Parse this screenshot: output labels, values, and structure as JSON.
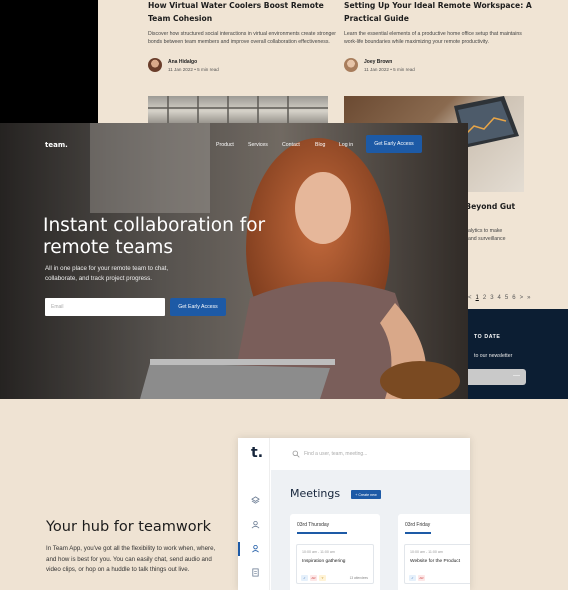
{
  "blog": {
    "posts": [
      {
        "title": "How Virtual Water Coolers Boost Remote Team Cohesion",
        "excerpt": "Discover how structured social interactions in virtual environments create stronger bonds between team members and improve overall collaboration effectiveness.",
        "author": "Ana Hidalgo",
        "meta": "11 Jan 2022  •  5 min read"
      },
      {
        "title": "Setting Up Your Ideal Remote Workspace: A Practical Guide",
        "excerpt": "Learn the essential elements of a productive home office setup that maintains work-life boundaries while maximizing your remote productivity.",
        "author": "Joey Brown",
        "meta": "11 Jan 2022  •  5 min read"
      }
    ],
    "partial_title": "t: Beyond Gut",
    "partial_excerpt": [
      "alytics to make",
      "and surveillance"
    ],
    "pagination": [
      "<",
      "1",
      "2",
      "3",
      "4",
      "5",
      "6",
      ">",
      "»"
    ]
  },
  "newsletter": {
    "title": "TO DATE",
    "subtitle": "to our newsletter",
    "arrow": "—"
  },
  "hero": {
    "logo": "team.",
    "nav": [
      "Product",
      "Services",
      "Contact",
      "Blog",
      "Log in"
    ],
    "nav_cta": "Get Early Access",
    "title": "Instant collaboration for remote teams",
    "subtitle": "All in one place for your remote team to chat, collaborate, and track project progress.",
    "email_placeholder": "Email",
    "cta": "Get Early Access"
  },
  "hub": {
    "title": "Your hub for teamwork",
    "body": "In Team App, you've got all the flexibility to work when, where, and how is best for you. You can easily chat, send audio and video clips, or hop on a huddle to talk things out live."
  },
  "app": {
    "logo": "t.",
    "search_placeholder": "Find a user, team, meeting...",
    "section_title": "Meetings",
    "create_button": "+ Create new",
    "cards": [
      {
        "day": "03rd Thursday",
        "time": "10:00 am - 11:00 am",
        "event": "Inspiration gathering",
        "participants": "13 attendees"
      },
      {
        "day": "03rd Friday",
        "time": "10:00 am - 11:00 am",
        "event": "Website for the Product",
        "participants": ""
      }
    ],
    "tags": [
      "✓",
      "AR",
      "Y"
    ],
    "colors": {
      "accent": "#1d5aa6",
      "navy": "#15243a"
    }
  }
}
